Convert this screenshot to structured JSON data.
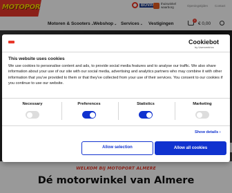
{
  "site": {
    "logo_text": "MOTOPORT",
    "badges": {
      "bovag": "BOVAG",
      "thuiswinkel_line1": "thuiswinkel",
      "thuiswinkel_line2": "waarborg"
    },
    "top_links": [
      "Openingstijden",
      "Contact"
    ],
    "nav": [
      {
        "label": "Motoren & Scooters",
        "has_caret": true
      },
      {
        "label": "Webshop",
        "has_caret": true
      },
      {
        "label": "Services",
        "has_caret": true
      },
      {
        "label": "Vestigingen",
        "has_caret": false
      }
    ],
    "cart": {
      "count": "0",
      "amount": "€ 0,00"
    },
    "welcome": "WELKOM BIJ MOTOPORT ALMERE",
    "hero_title": "Dé motorwinkel van Almere"
  },
  "cookie_dialog": {
    "brand": "Cookiebot",
    "brand_sub": "by Usercentrics",
    "title": "This website uses cookies",
    "body": "We use cookies to personalise content and ads, to provide social media features and to analyse our traffic. We also share information about your use of our site with our social media, advertising and analytics partners who may combine it with other information that you've provided to them or that they've collected from your use of their services. You consent to our cookies if you continue to use our website.",
    "categories": [
      {
        "label": "Necessary",
        "enabled": false
      },
      {
        "label": "Preferences",
        "enabled": true
      },
      {
        "label": "Statistics",
        "enabled": true
      },
      {
        "label": "Marketing",
        "enabled": false
      }
    ],
    "show_details": "Show details",
    "allow_selection": "Allow selection",
    "allow_all": "Allow all cookies",
    "colors": {
      "accent": "#1032cf",
      "toggle_off": "#dddddd"
    }
  },
  "icons": [
    "cart-icon",
    "search-icon",
    "chevron-down-icon",
    "chevron-right-icon"
  ]
}
